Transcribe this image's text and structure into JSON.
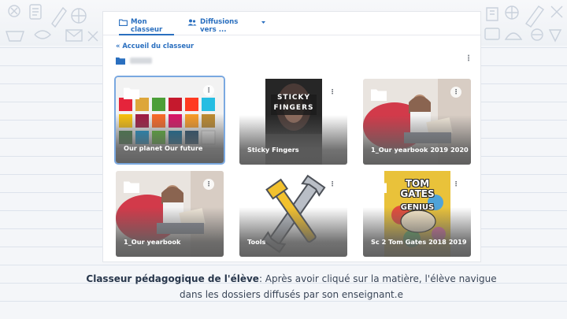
{
  "tabs": [
    {
      "label": "Mon classeur",
      "icon": "folder-icon"
    },
    {
      "label": "Diffusions vers ...",
      "icon": "users-icon"
    }
  ],
  "back_link": "« Accueil du classeur",
  "more_glyph": "⋮",
  "folders": [
    {
      "title": "Our planet Our future",
      "art": "sdg-goals-grid",
      "selected": true
    },
    {
      "title": "Sticky Fingers",
      "art": "book-cover",
      "cover_words": [
        "STICKY",
        "FINGERS"
      ]
    },
    {
      "title": "1_Our yearbook 2019 2020",
      "art": "student-reading-photo"
    },
    {
      "title": "1_Our yearbook",
      "art": "student-reading-photo"
    },
    {
      "title": "Tools",
      "art": "wrench-illustration"
    },
    {
      "title": "Sc 2 Tom Gates 2018 2019",
      "art": "book-cover",
      "cover_words": [
        "TOM",
        "GATES",
        "GENIUS"
      ]
    }
  ],
  "caption": {
    "strong": "Classeur pédagogique de l'élève",
    "rest": ": Après avoir cliqué sur la matière, l'élève navigue dans les dossiers diffusés par son enseignant.e"
  },
  "colors": {
    "accent": "#2a6fbf",
    "folder": "#ffffff",
    "background": "#f4f6f9"
  }
}
